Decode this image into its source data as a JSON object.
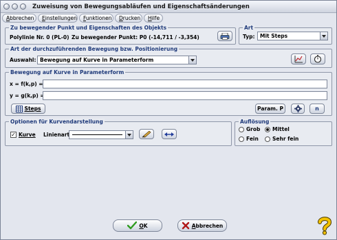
{
  "window": {
    "title": "Zuweisung von Bewegungsabläufen und Eigenschaftsänderungen"
  },
  "menu": {
    "items": [
      {
        "first": "A",
        "rest": "bbrechen"
      },
      {
        "first": "E",
        "rest": "instellungen"
      },
      {
        "first": "F",
        "rest": "unktionen"
      },
      {
        "first": "D",
        "rest": "rucken"
      },
      {
        "first": "H",
        "rest": "ilfe"
      }
    ]
  },
  "object_group": {
    "legend": "Zu bewegender Punkt und Eigenschaften des Objekts",
    "polyline": "Polylinie Nr. 0 (PL-0)",
    "point": "Zu bewegender Punkt: P0 (-14,711 / -3,354)"
  },
  "art_group": {
    "legend": "Art",
    "type_label": "Typ:",
    "type_value": "Mit Steps"
  },
  "movement_group": {
    "legend": "Art der durchzuführenden Bewegung bzw. Positionierung",
    "select_label": "Auswahl:",
    "select_value": "Bewegung auf Kurve in Parameterform"
  },
  "curve_group": {
    "legend": "Bewegung auf Kurve in Parameterform",
    "x_label": "x = f(k,p) =",
    "x_value": "",
    "y_label": "y = g(k,p) =",
    "y_value": "",
    "steps_label": "Steps",
    "param_label": "Param. P",
    "n_label": "n"
  },
  "options_group": {
    "legend": "Optionen für Kurvendarstellung",
    "curve_checkbox_label": "Kurve",
    "curve_checked": true,
    "linetype_label": "Linienart:",
    "linetype_value": "",
    "line_color": "#000000"
  },
  "resolution_group": {
    "legend": "Auflösung",
    "options": [
      "Grob",
      "Mittel",
      "Fein",
      "Sehr fein"
    ],
    "selected": "Mittel"
  },
  "footer": {
    "ok_first": "O",
    "ok_rest": "K",
    "cancel_first": "A",
    "cancel_rest": "bbrechen"
  },
  "colors": {
    "legend_text": "#1f3a7a",
    "ok_check": "#2e9b1f",
    "cancel_x": "#b01818",
    "help_icon": "#f2c200"
  }
}
